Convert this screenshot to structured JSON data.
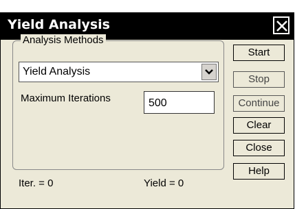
{
  "window": {
    "title": "Yield Analysis",
    "close_icon": "close-icon"
  },
  "analysis_methods": {
    "group_label": "Analysis Methods",
    "selected_method": "Yield Analysis",
    "dropdown_icon": "chevron-down-icon"
  },
  "iterations": {
    "label": "Maximum Iterations",
    "value": "500"
  },
  "buttons": {
    "start": "Start",
    "stop": "Stop",
    "continue": "Continue",
    "clear": "Clear",
    "close": "Close",
    "help": "Help"
  },
  "status": {
    "iter": "Iter. = 0",
    "yield": "Yield = 0"
  },
  "colors": {
    "titlebar": "#000000",
    "window_bg": "#ece9d8"
  }
}
